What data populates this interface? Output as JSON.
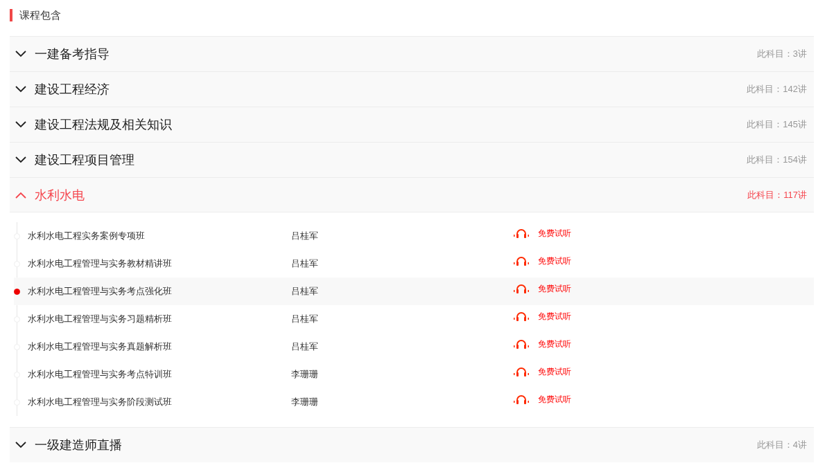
{
  "heading": {
    "title": "课程包含"
  },
  "sections": [
    {
      "title": "一建备考指导",
      "count": "此科目：3讲",
      "expanded": false
    },
    {
      "title": "建设工程经济",
      "count": "此科目：142讲",
      "expanded": false
    },
    {
      "title": "建设工程法规及相关知识",
      "count": "此科目：145讲",
      "expanded": false
    },
    {
      "title": "建设工程项目管理",
      "count": "此科目：154讲",
      "expanded": false
    },
    {
      "title": "水利水电",
      "count": "此科目：117讲",
      "expanded": true,
      "lessons": [
        {
          "title": "水利水电工程实务案例专项班",
          "teacher": "吕桂军",
          "trial": "免费试听",
          "selected": false
        },
        {
          "title": "水利水电工程管理与实务教材精讲班",
          "teacher": "吕桂军",
          "trial": "免费试听",
          "selected": false
        },
        {
          "title": "水利水电工程管理与实务考点强化班",
          "teacher": "吕桂军",
          "trial": "免费试听",
          "selected": true
        },
        {
          "title": "水利水电工程管理与实务习题精析班",
          "teacher": "吕桂军",
          "trial": "免费试听",
          "selected": false
        },
        {
          "title": "水利水电工程管理与实务真题解析班",
          "teacher": "吕桂军",
          "trial": "免费试听",
          "selected": false
        },
        {
          "title": "水利水电工程管理与实务考点特训班",
          "teacher": "李珊珊",
          "trial": "免费试听",
          "selected": false
        },
        {
          "title": "水利水电工程管理与实务阶段测试班",
          "teacher": "李珊珊",
          "trial": "免费试听",
          "selected": false
        }
      ]
    },
    {
      "title": "一级建造师直播",
      "count": "此科目：4讲",
      "expanded": false
    }
  ]
}
